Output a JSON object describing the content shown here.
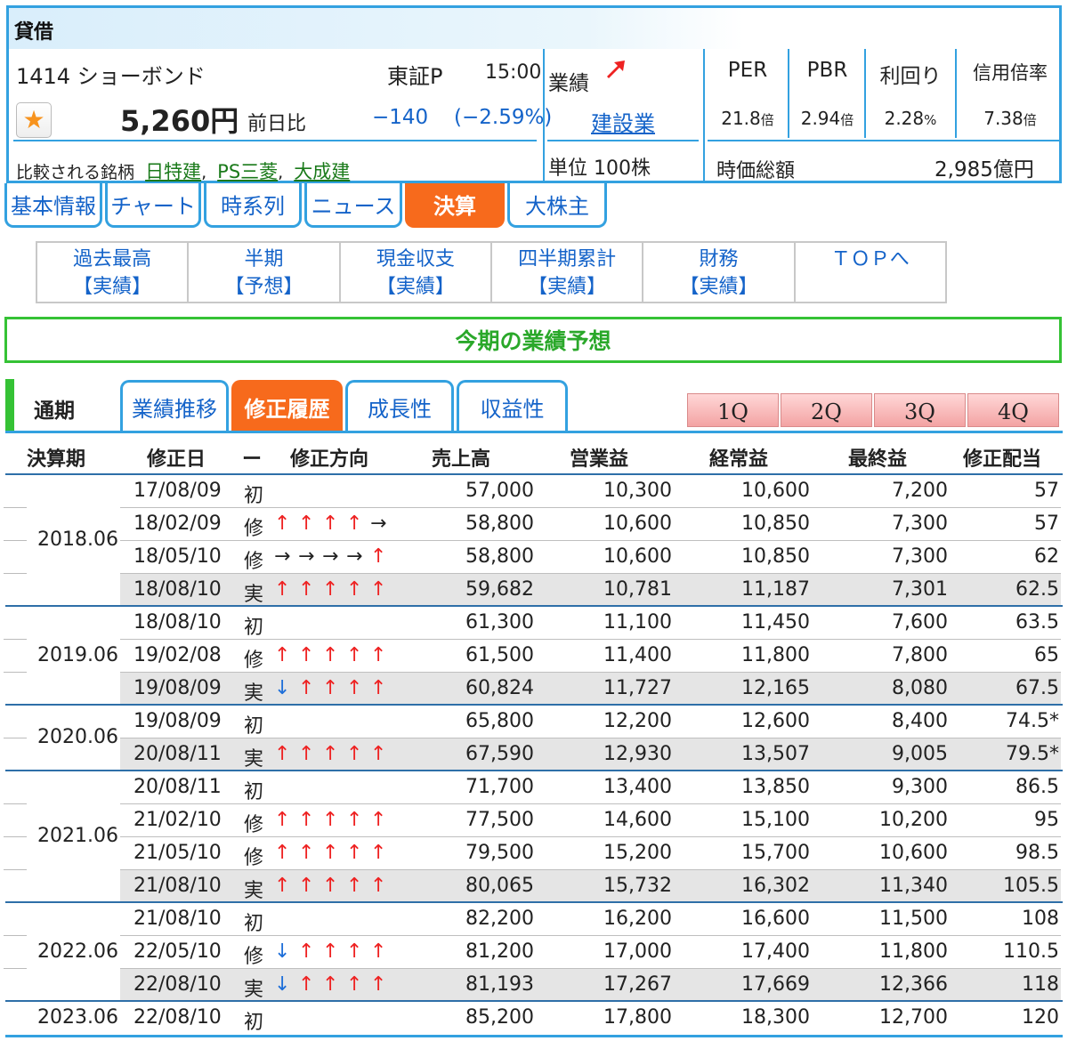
{
  "header": {
    "section_label": "貸借",
    "stock_title": "1414 ショーボンド",
    "market": "東証P",
    "time": "15:00",
    "price": "5,260円",
    "change_label": "前日比",
    "change_value": "−140",
    "change_pct": "(−2.59%)",
    "gyoseki_label": "業績",
    "industry": "建設業",
    "unit": "単位 100株",
    "compare_label": "比較される銘柄",
    "compare_links": [
      "日特建",
      "PS三菱",
      "大成建"
    ],
    "comma": ",",
    "kpis": [
      {
        "label": "PER",
        "value": "21.8",
        "unit": "倍"
      },
      {
        "label": "PBR",
        "value": "2.94",
        "unit": "倍"
      },
      {
        "label": "利回り",
        "value": "2.28",
        "unit": "%"
      },
      {
        "label": "信用倍率",
        "value": "7.38",
        "unit": "倍"
      }
    ],
    "market_cap_label": "時価総額",
    "market_cap_value": "2,985億円"
  },
  "tabs": [
    "基本情報",
    "チャート",
    "時系列",
    "ニュース",
    "決算",
    "大株主"
  ],
  "active_tab": "決算",
  "subnav": [
    {
      "top": "過去最高",
      "bottom": "【実績】"
    },
    {
      "top": "半期",
      "bottom": "【予想】"
    },
    {
      "top": "現金収支",
      "bottom": "【実績】"
    },
    {
      "top": "四半期累計",
      "bottom": "【実績】"
    },
    {
      "top": "財務",
      "bottom": "【実績】"
    },
    {
      "top": "ＴＯＰへ",
      "bottom": ""
    }
  ],
  "section_title": "今期の業績予想",
  "period_label": "通期",
  "sub_tabs": [
    "業績推移",
    "修正履歴",
    "成長性",
    "収益性"
  ],
  "active_sub_tab": "修正履歴",
  "quarter_buttons": [
    "1Q",
    "2Q",
    "3Q",
    "4Q"
  ],
  "columns": [
    "決算期",
    "修正日",
    "ー",
    "修正方向",
    "売上高",
    "営業益",
    "経常益",
    "最終益",
    "修正配当"
  ],
  "groups": [
    {
      "period": "2018.06",
      "rows": [
        {
          "date": "17/08/09",
          "type": "初",
          "dir": [],
          "sales": "57,000",
          "op": "10,300",
          "ord": "10,600",
          "net": "7,200",
          "div": "57"
        },
        {
          "date": "18/02/09",
          "type": "修",
          "dir": [
            "up",
            "up",
            "up",
            "up",
            "right"
          ],
          "sales": "58,800",
          "op": "10,600",
          "ord": "10,850",
          "net": "7,300",
          "div": "57"
        },
        {
          "date": "18/05/10",
          "type": "修",
          "dir": [
            "right",
            "right",
            "right",
            "right",
            "up"
          ],
          "sales": "58,800",
          "op": "10,600",
          "ord": "10,850",
          "net": "7,300",
          "div": "62"
        },
        {
          "date": "18/08/10",
          "type": "実",
          "dir": [
            "up",
            "up",
            "up",
            "up",
            "up"
          ],
          "sales": "59,682",
          "op": "10,781",
          "ord": "11,187",
          "net": "7,301",
          "div": "62.5"
        }
      ]
    },
    {
      "period": "2019.06",
      "rows": [
        {
          "date": "18/08/10",
          "type": "初",
          "dir": [],
          "sales": "61,300",
          "op": "11,100",
          "ord": "11,450",
          "net": "7,600",
          "div": "63.5"
        },
        {
          "date": "19/02/08",
          "type": "修",
          "dir": [
            "up",
            "up",
            "up",
            "up",
            "up"
          ],
          "sales": "61,500",
          "op": "11,400",
          "ord": "11,800",
          "net": "7,800",
          "div": "65"
        },
        {
          "date": "19/08/09",
          "type": "実",
          "dir": [
            "down",
            "up",
            "up",
            "up",
            "up"
          ],
          "sales": "60,824",
          "op": "11,727",
          "ord": "12,165",
          "net": "8,080",
          "div": "67.5"
        }
      ]
    },
    {
      "period": "2020.06",
      "rows": [
        {
          "date": "19/08/09",
          "type": "初",
          "dir": [],
          "sales": "65,800",
          "op": "12,200",
          "ord": "12,600",
          "net": "8,400",
          "div": "74.5*"
        },
        {
          "date": "20/08/11",
          "type": "実",
          "dir": [
            "up",
            "up",
            "up",
            "up",
            "up"
          ],
          "sales": "67,590",
          "op": "12,930",
          "ord": "13,507",
          "net": "9,005",
          "div": "79.5*"
        }
      ]
    },
    {
      "period": "2021.06",
      "rows": [
        {
          "date": "20/08/11",
          "type": "初",
          "dir": [],
          "sales": "71,700",
          "op": "13,400",
          "ord": "13,850",
          "net": "9,300",
          "div": "86.5"
        },
        {
          "date": "21/02/10",
          "type": "修",
          "dir": [
            "up",
            "up",
            "up",
            "up",
            "up"
          ],
          "sales": "77,500",
          "op": "14,600",
          "ord": "15,100",
          "net": "10,200",
          "div": "95"
        },
        {
          "date": "21/05/10",
          "type": "修",
          "dir": [
            "up",
            "up",
            "up",
            "up",
            "up"
          ],
          "sales": "79,500",
          "op": "15,200",
          "ord": "15,700",
          "net": "10,600",
          "div": "98.5"
        },
        {
          "date": "21/08/10",
          "type": "実",
          "dir": [
            "up",
            "up",
            "up",
            "up",
            "up"
          ],
          "sales": "80,065",
          "op": "15,732",
          "ord": "16,302",
          "net": "11,340",
          "div": "105.5"
        }
      ]
    },
    {
      "period": "2022.06",
      "rows": [
        {
          "date": "21/08/10",
          "type": "初",
          "dir": [],
          "sales": "82,200",
          "op": "16,200",
          "ord": "16,600",
          "net": "11,500",
          "div": "108"
        },
        {
          "date": "22/05/10",
          "type": "修",
          "dir": [
            "down",
            "up",
            "up",
            "up",
            "up"
          ],
          "sales": "81,200",
          "op": "17,000",
          "ord": "17,400",
          "net": "11,800",
          "div": "110.5"
        },
        {
          "date": "22/08/10",
          "type": "実",
          "dir": [
            "down",
            "up",
            "up",
            "up",
            "up"
          ],
          "sales": "81,193",
          "op": "17,267",
          "ord": "17,669",
          "net": "12,366",
          "div": "118"
        }
      ]
    },
    {
      "period": "2023.06",
      "rows": [
        {
          "date": "22/08/10",
          "type": "初",
          "dir": [],
          "sales": "85,200",
          "op": "17,800",
          "ord": "18,300",
          "net": "12,700",
          "div": "120"
        }
      ]
    }
  ],
  "arrow_glyphs": {
    "up": "↑",
    "down": "↓",
    "right": "→"
  },
  "colors": {
    "accent_blue": "#33a1e0",
    "active_orange": "#f76a1c",
    "section_green": "#35c235",
    "up_red": "#ee2222",
    "down_blue": "#1e6fd9",
    "link_green": "#1a7a1a"
  }
}
